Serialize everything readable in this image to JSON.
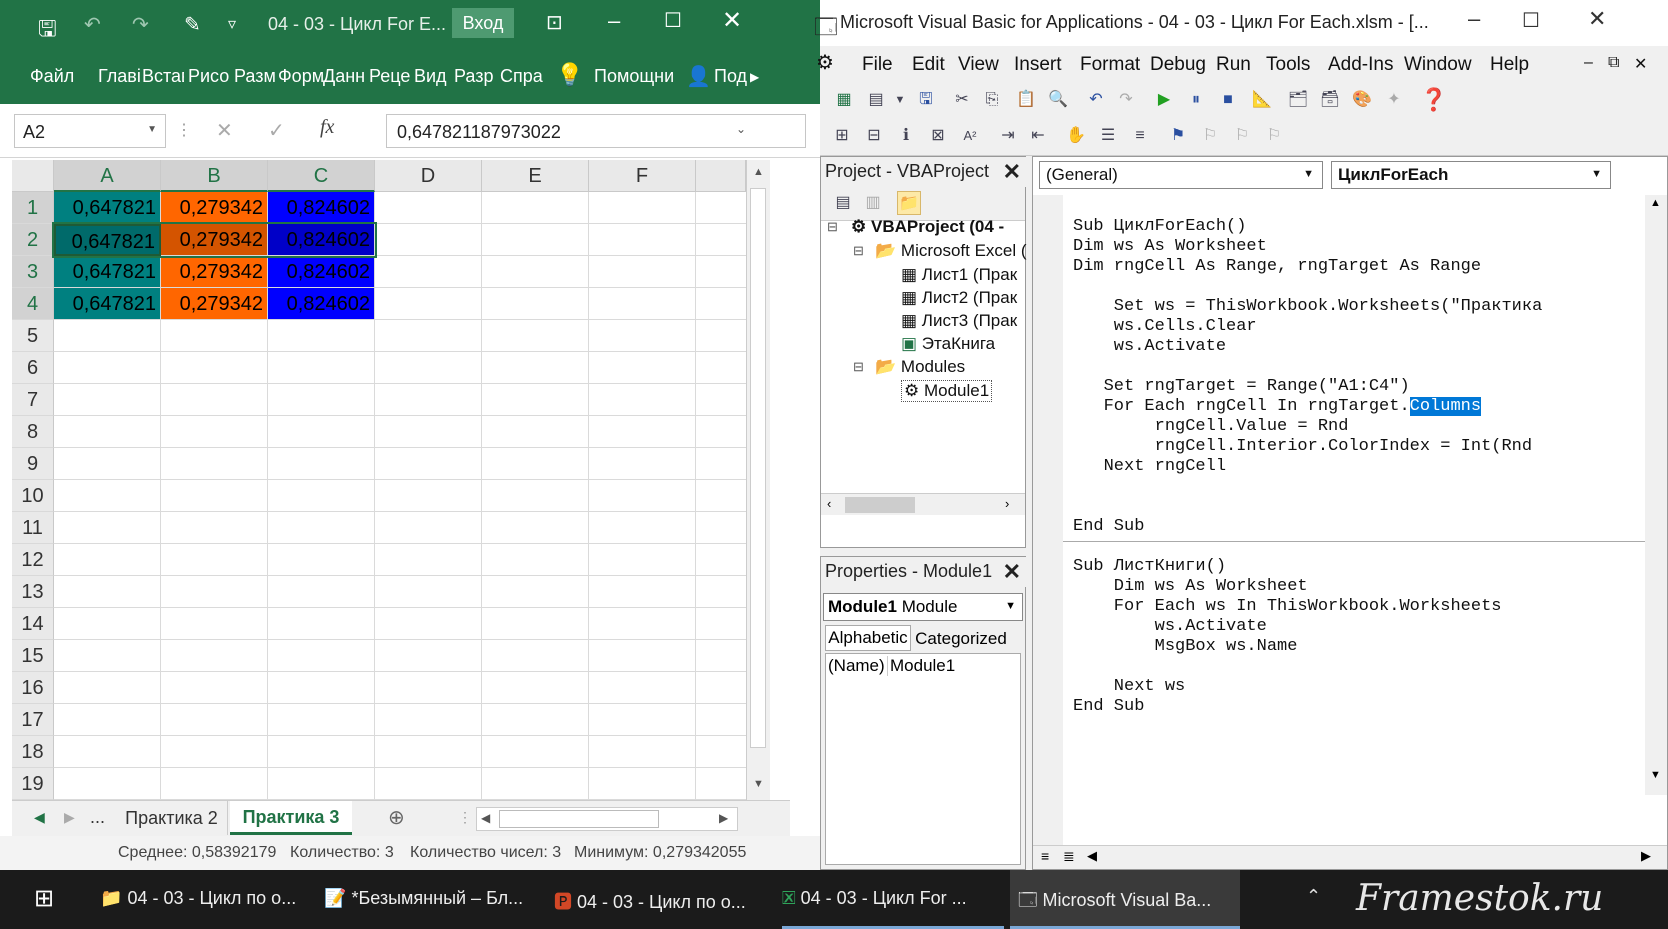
{
  "excel": {
    "title": "04 - 03 - Цикл For E...",
    "signin_label": "Вход",
    "ribbon_tabs": [
      "Файл",
      "Главі",
      "Вставі",
      "Рисо",
      "Разм",
      "Форм",
      "Данн",
      "Реце",
      "Вид",
      "Разр",
      "Спра",
      "Помощни",
      "Под"
    ],
    "name_box": "A2",
    "fx_label": "fx",
    "formula_value": "0,647821187973022",
    "columns": [
      "A",
      "B",
      "C",
      "D",
      "E",
      "F"
    ],
    "rows": [
      "1",
      "2",
      "3",
      "4",
      "5",
      "6",
      "7",
      "8",
      "9",
      "10",
      "11",
      "12",
      "13",
      "14",
      "15",
      "16",
      "17",
      "18",
      "19"
    ],
    "cells": [
      [
        "0,647821",
        "0,279342",
        "0,824602"
      ],
      [
        "0,647821",
        "0,279342",
        "0,824602"
      ],
      [
        "0,647821",
        "0,279342",
        "0,824602"
      ],
      [
        "0,647821",
        "0,279342",
        "0,824602"
      ]
    ],
    "fill_colors": {
      "A": "#008080",
      "B": "#ff6600",
      "C": "#0000ff"
    },
    "sheet_tabs": {
      "ellipsis": "...",
      "tab1": "Практика 2",
      "tab2": "Практика 3"
    },
    "status": {
      "average": "Среднее: 0,58392179",
      "count": "Количество: 3",
      "numeric_count": "Количество чисел: 3",
      "minimum": "Минимум: 0,279342055"
    }
  },
  "vba": {
    "title": "Microsoft Visual Basic for Applications - 04 - 03 - Цикл For Each.xlsm - [...",
    "menu": [
      "File",
      "Edit",
      "View",
      "Insert",
      "Format",
      "Debug",
      "Run",
      "Tools",
      "Add-Ins",
      "Window",
      "Help"
    ],
    "project_title": "Project - VBAProject",
    "tree": {
      "root": "VBAProject (04 -",
      "excel_objects": "Microsoft Excel (",
      "sheet1": "Лист1 (Прак",
      "sheet2": "Лист2 (Прак",
      "sheet3": "Лист3 (Прак",
      "thisbook": "ЭтаКнига",
      "modules": "Modules",
      "module1": "Module1"
    },
    "properties_title": "Properties - Module1",
    "properties_object": "Module1",
    "properties_type": "Module",
    "properties_tabs": [
      "Alphabetic",
      "Categorized"
    ],
    "properties_row": {
      "name": "(Name)",
      "value": "Module1"
    },
    "combo_general": "(General)",
    "combo_proc": "ЦиклForEach",
    "code_lines": [
      "Sub ЦиклForEach()",
      "Dim ws As Worksheet",
      "Dim rngCell As Range, rngTarget As Range",
      "",
      "    Set ws = ThisWorkbook.Worksheets(\"Практика",
      "    ws.Cells.Clear",
      "    ws.Activate",
      "",
      "   Set rngTarget = Range(\"A1:C4\")",
      "   For Each rngCell In rngTarget.",
      "        rngCell.Value = Rnd",
      "        rngCell.Interior.ColorIndex = Int(Rnd",
      "   Next rngCell",
      "",
      "",
      "End Sub"
    ],
    "selected_word": "Columns",
    "code_lines2": [
      "Sub ЛистКниги()",
      "    Dim ws As Worksheet",
      "    For Each ws In ThisWorkbook.Worksheets",
      "        ws.Activate",
      "        MsgBox ws.Name",
      "",
      "    Next ws",
      "End Sub"
    ]
  },
  "taskbar": {
    "apps": [
      "04 - 03 - Цикл по о...",
      "*Безымянный – Бл...",
      "04 - 03 - Цикл по о...",
      "04 - 03 - Цикл For ...",
      "Microsoft Visual Ba..."
    ],
    "watermark": "Framestok.ru"
  }
}
